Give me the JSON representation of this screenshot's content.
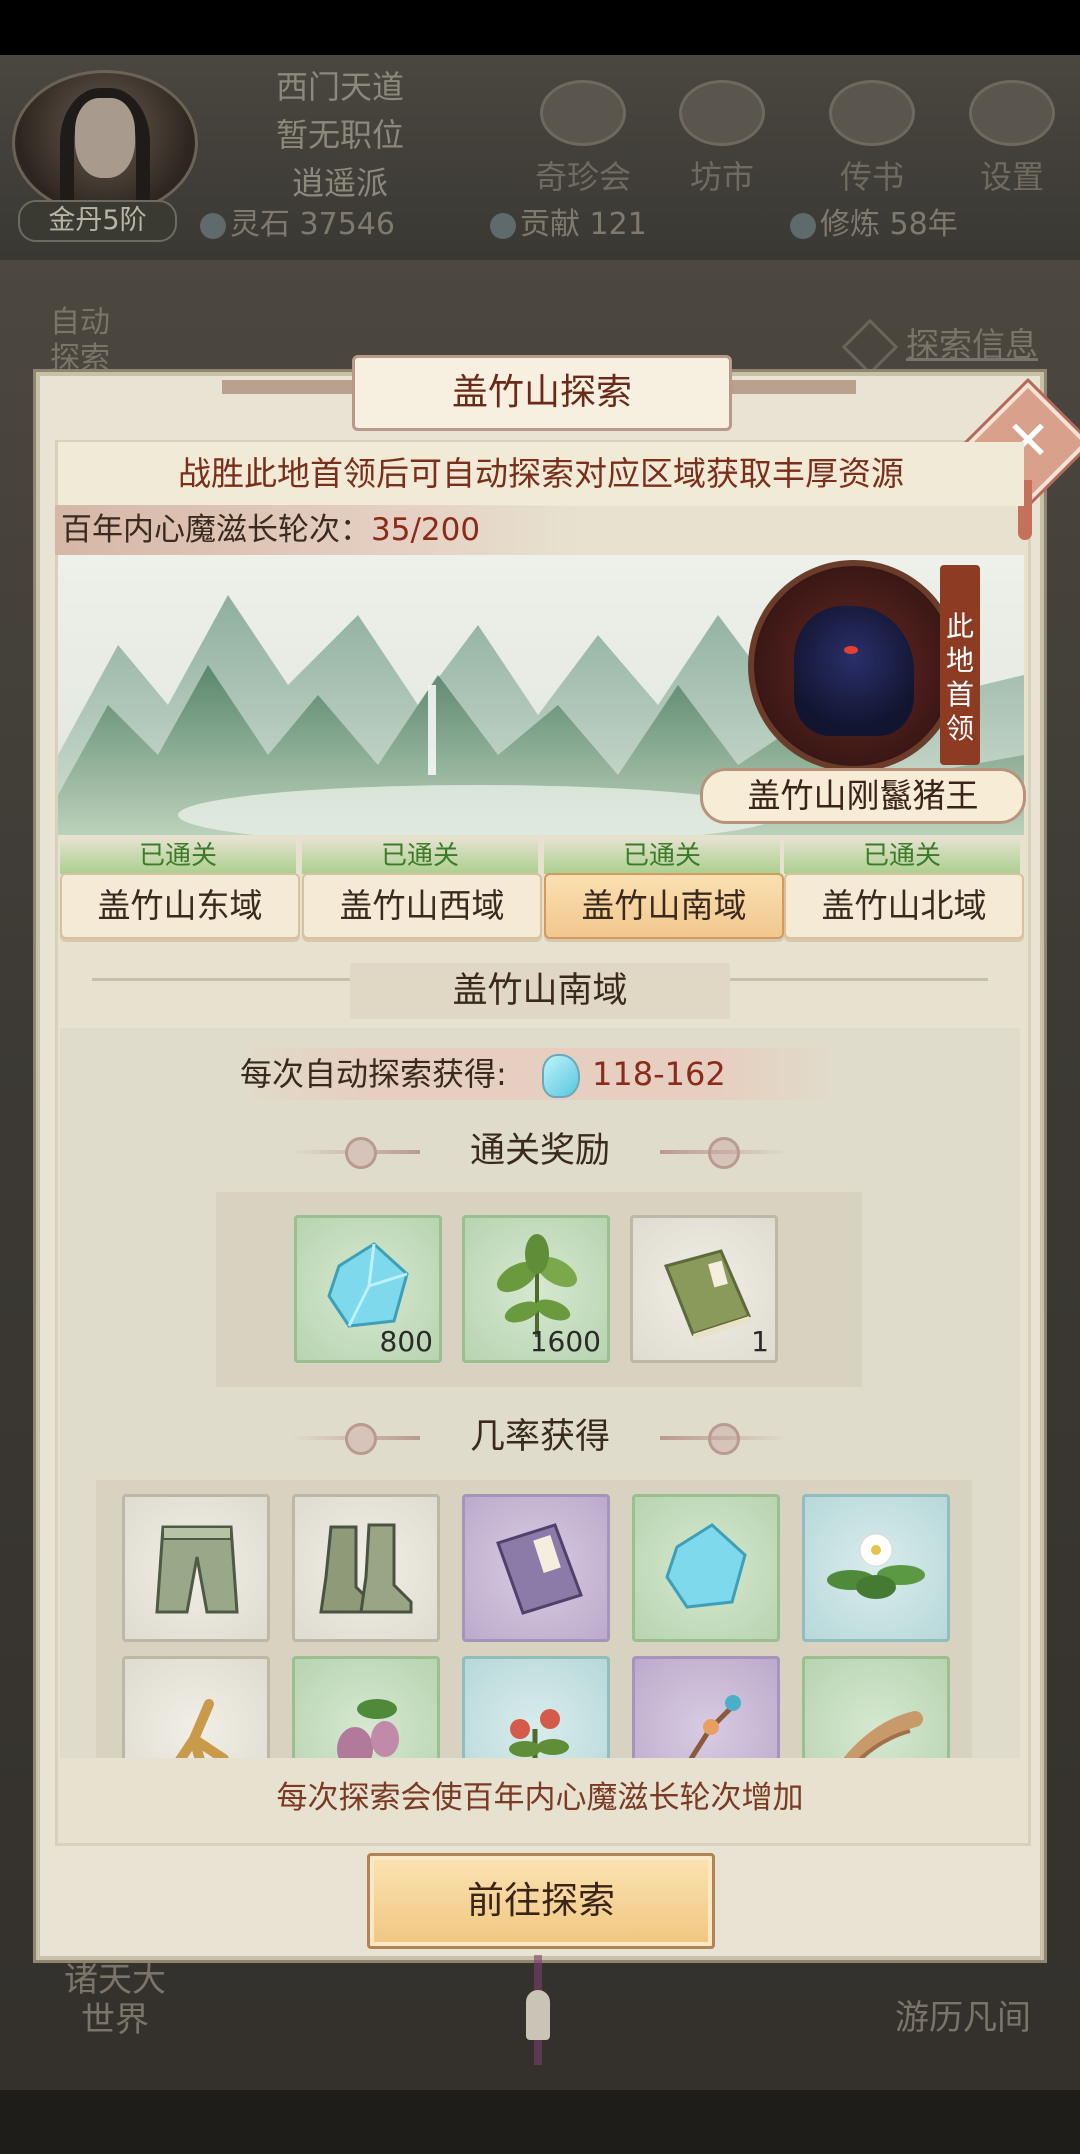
{
  "player": {
    "name": "西门天道",
    "position": "暂无职位",
    "sect": "逍遥派",
    "rank": "金丹5阶"
  },
  "top_menu": [
    {
      "label": "奇珍会",
      "icon": "treasure-icon"
    },
    {
      "label": "坊市",
      "icon": "market-icon"
    },
    {
      "label": "传书",
      "icon": "letter-icon"
    },
    {
      "label": "设置",
      "icon": "gear-icon"
    }
  ],
  "stats": {
    "spirit_stone": "灵石 37546",
    "contribution": "贡献 121",
    "cultivation": "修炼 58年"
  },
  "background": {
    "auto_explore": "自动探索",
    "explore_info": "探索信息",
    "world": "诸天大世界",
    "travel": "游历凡间"
  },
  "modal": {
    "title": "盖竹山探索",
    "tip": "战胜此地首领后可自动探索对应区域获取丰厚资源",
    "rounds_label": "百年内心魔滋长轮次：",
    "rounds_value": "35/200",
    "boss_tag": "此地首领",
    "boss_name": "盖竹山刚鬣猪王",
    "regions": [
      {
        "name": "盖竹山东域",
        "status": "已通关",
        "selected": false
      },
      {
        "name": "盖竹山西域",
        "status": "已通关",
        "selected": false
      },
      {
        "name": "盖竹山南域",
        "status": "已通关",
        "selected": true
      },
      {
        "name": "盖竹山北域",
        "status": "已通关",
        "selected": false
      }
    ],
    "section_title": "盖竹山南域",
    "yield_label": "每次自动探索获得:",
    "yield_value": "118-162",
    "clear_reward_title": "通关奖励",
    "clear_rewards": [
      {
        "icon": "spirit-stone-icon",
        "count": "800",
        "rarity": "green"
      },
      {
        "icon": "herb-icon",
        "count": "1600",
        "rarity": "green"
      },
      {
        "icon": "manual-book-icon",
        "count": "1",
        "rarity": "white"
      }
    ],
    "drop_title": "几率获得",
    "drops": [
      {
        "icon": "pants-icon",
        "rarity": "white"
      },
      {
        "icon": "boots-icon",
        "rarity": "white"
      },
      {
        "icon": "secret-book-icon",
        "rarity": "purple"
      },
      {
        "icon": "spirit-stone-icon",
        "rarity": "green"
      },
      {
        "icon": "flower-herb-icon",
        "rarity": "blue"
      },
      {
        "icon": "ginseng-icon",
        "rarity": "white"
      },
      {
        "icon": "berry-herb-icon",
        "rarity": "green"
      },
      {
        "icon": "red-flower-icon",
        "rarity": "blue"
      },
      {
        "icon": "fruit-branch-icon",
        "rarity": "purple"
      },
      {
        "icon": "root-herb-icon",
        "rarity": "green"
      }
    ],
    "note": "每次探索会使百年内心魔滋长轮次增加",
    "go_button": "前往探索"
  }
}
